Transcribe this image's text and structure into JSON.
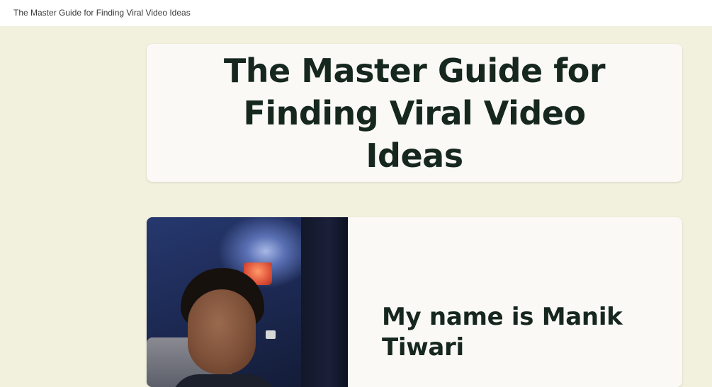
{
  "window": {
    "title": "The Master Guide for Finding Viral Video Ideas"
  },
  "hero": {
    "title": "The Master Guide for Finding Viral Video Ideas"
  },
  "intro": {
    "heading": "My name is Manik Tiwari",
    "photo_icon": "portrait-photo"
  },
  "colors": {
    "page_background": "#f1f1de",
    "card_background": "#faf9f6",
    "heading_text": "#16271e"
  }
}
